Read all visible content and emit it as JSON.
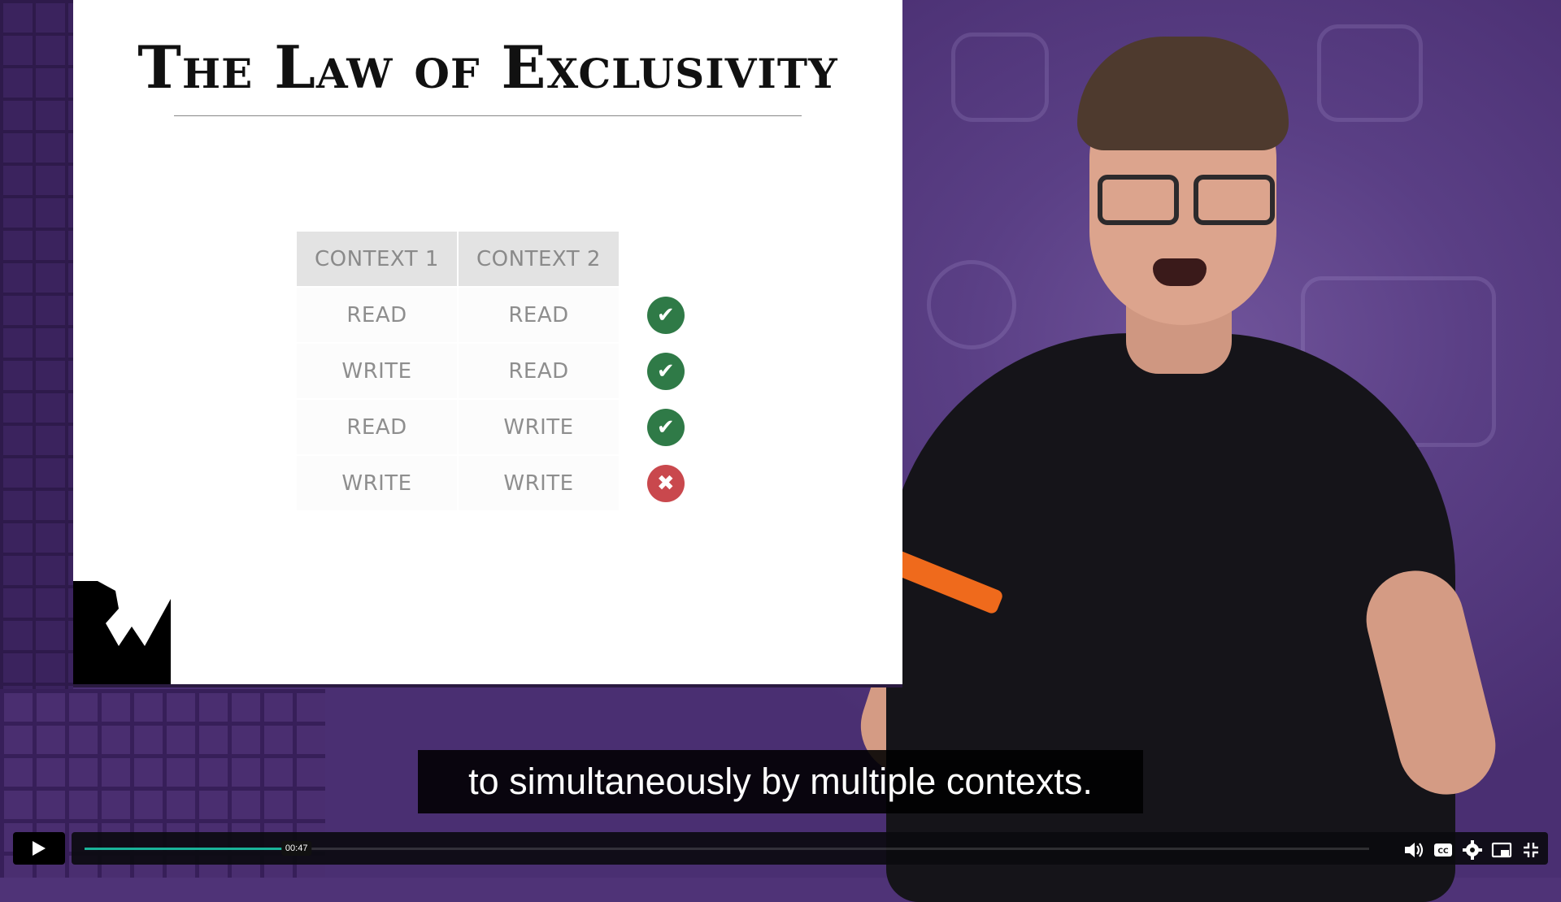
{
  "slide": {
    "title": "The Law of Exclusivity",
    "table": {
      "headers": [
        "CONTEXT 1",
        "CONTEXT 2"
      ],
      "rows": [
        {
          "c1": "READ",
          "c2": "READ",
          "status": "allowed"
        },
        {
          "c1": "WRITE",
          "c2": "READ",
          "status": "allowed"
        },
        {
          "c1": "READ",
          "c2": "WRITE",
          "status": "allowed"
        },
        {
          "c1": "WRITE",
          "c2": "WRITE",
          "status": "conflict"
        }
      ],
      "status_icons": {
        "allowed": "check-circle-icon",
        "conflict": "x-circle-icon"
      },
      "colors": {
        "allowed": "#2f7a47",
        "conflict": "#c9484d"
      }
    }
  },
  "caption": {
    "text": "to simultaneously by multiple contexts."
  },
  "player": {
    "current_time": "00:47",
    "progress": 0.165,
    "accent_color": "#1ab39a",
    "controls": [
      "play-icon",
      "volume-icon",
      "closed-captions-icon",
      "settings-icon",
      "picture-in-picture-icon",
      "exit-fullscreen-icon"
    ]
  }
}
